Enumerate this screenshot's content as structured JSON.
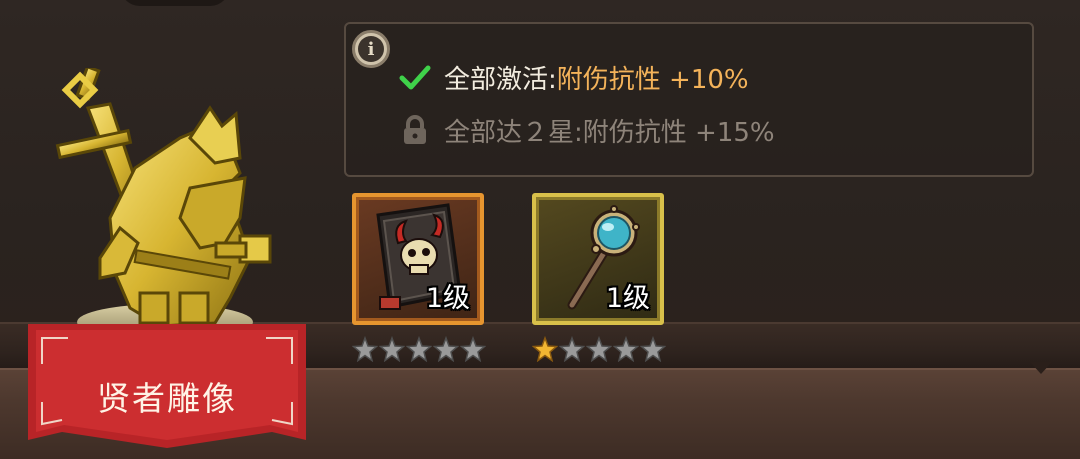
{
  "statue": {
    "name": "贤者雕像",
    "icon": "golden-dwarf-statue"
  },
  "info_panel": {
    "info_icon_glyph": "i",
    "bonuses": [
      {
        "condition": "全部激活:",
        "effect": "附伤抗性 +10%",
        "status": "active",
        "icon": "check-icon"
      },
      {
        "condition": "全部达２星:",
        "effect": "附伤抗性 +15%",
        "status": "locked",
        "icon": "lock-icon"
      }
    ]
  },
  "items": [
    {
      "name": "skull-book",
      "level_label": "1级",
      "stars_filled": 0,
      "stars_total": 5,
      "rarity_color": "#e6952f"
    },
    {
      "name": "crystal-scepter",
      "level_label": "1级",
      "stars_filled": 1,
      "stars_total": 5,
      "rarity_color": "#d8c04a"
    }
  ],
  "colors": {
    "active_text": "#f2ecdf",
    "active_effect": "#f4b35a",
    "locked_text": "#8e847a",
    "banner_red": "#c0282b",
    "star_gold": "#f2b632",
    "star_gray": "#9a9a9a"
  }
}
